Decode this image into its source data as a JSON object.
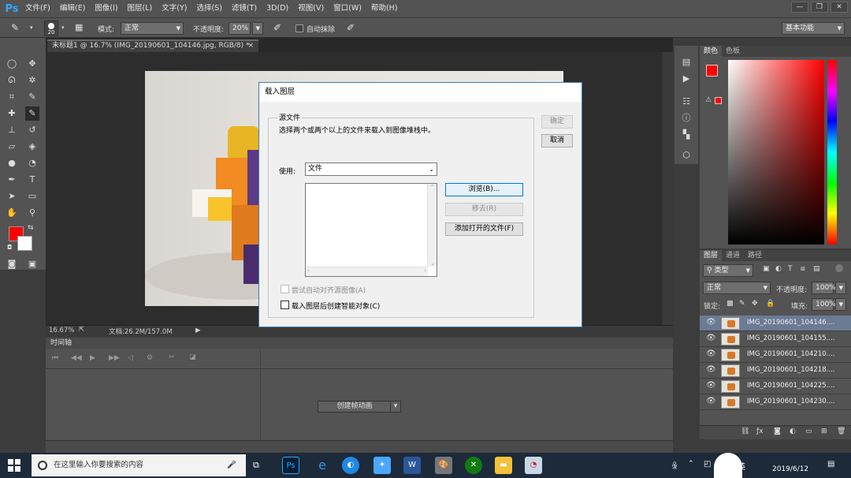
{
  "app": {
    "logo": "Ps"
  },
  "menu": [
    "文件(F)",
    "编辑(E)",
    "图像(I)",
    "图层(L)",
    "文字(Y)",
    "选择(S)",
    "滤镜(T)",
    "3D(D)",
    "视图(V)",
    "窗口(W)",
    "帮助(H)"
  ],
  "window_controls": [
    "—",
    "❐",
    "✕"
  ],
  "options": {
    "brush_size": "20",
    "mode_label": "模式:",
    "mode_value": "正常",
    "opacity_label": "不透明度:",
    "opacity_value": "20%",
    "auto_erase_label": "自动抹除",
    "workspace": "基本功能"
  },
  "document": {
    "tab_title": "未标题1 @ 16.7% (IMG_20190601_104146.jpg, RGB/8) *",
    "tab_close": "×"
  },
  "status": {
    "zoom": "16.67%",
    "doc_info": "文档:26.2M/157.0M"
  },
  "timeline": {
    "title": "时间轴",
    "create_button": "创建帧动画"
  },
  "color_panel": {
    "tabs": [
      "颜色",
      "色板"
    ],
    "fg_color": "#ff0000",
    "bg_color": "#ffffff"
  },
  "layers_panel": {
    "tabs": [
      "图层",
      "通道",
      "路径"
    ],
    "filter_label": "类型",
    "blend_mode": "正常",
    "opacity_label": "不透明度:",
    "opacity_value": "100%",
    "lock_label": "锁定:",
    "fill_label": "填充:",
    "fill_value": "100%",
    "layers": [
      "IMG_20190601_104146....",
      "IMG_20190601_104155....",
      "IMG_20190601_104210....",
      "IMG_20190601_104218....",
      "IMG_20190601_104225....",
      "IMG_20190601_104230...."
    ]
  },
  "dialog": {
    "title": "载入图层",
    "group_label": "源文件",
    "instruction": "选择两个或两个以上的文件来载入到图像堆栈中。",
    "use_label": "使用:",
    "use_value": "文件",
    "browse_button": "浏览(B)...",
    "remove_button": "移去(R)",
    "add_open_button": "添加打开的文件(F)",
    "auto_align_label": "尝试自动对齐源图像(A)",
    "smart_object_label": "载入图层后创建智能对象(C)",
    "ok_button": "确定",
    "cancel_button": "取消"
  },
  "taskbar": {
    "search_placeholder": "在这里输入你要搜索的内容",
    "ime": "英",
    "date": "2019/6/12"
  }
}
